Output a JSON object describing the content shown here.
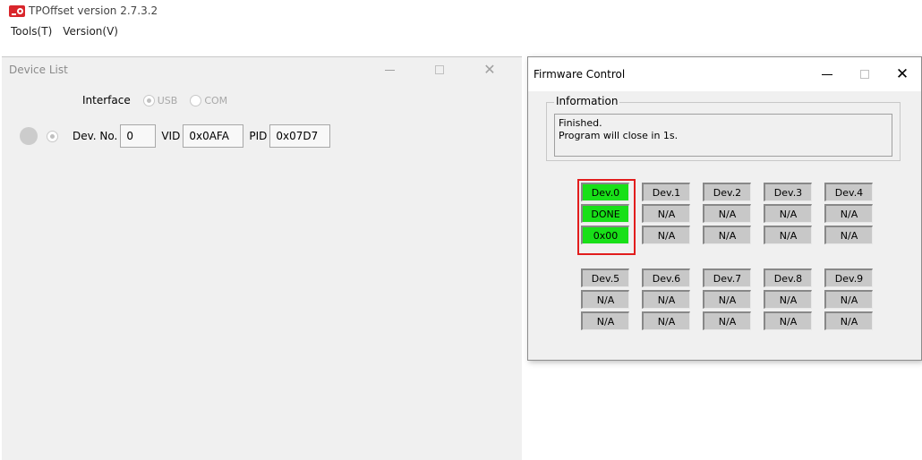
{
  "app": {
    "title": "TPOffset version 2.7.3.2",
    "logo_icon": "tpoffset-logo-icon"
  },
  "menu": [
    {
      "label": "Tools(T)"
    },
    {
      "label": "Version(V)"
    }
  ],
  "device_list": {
    "title": "Device List",
    "controls": {
      "minimize": "—",
      "maximize": "",
      "close": "✕"
    },
    "interface": {
      "label": "Interface",
      "options": [
        {
          "label": "USB",
          "selected": true,
          "enabled": false
        },
        {
          "label": "COM",
          "selected": false,
          "enabled": false
        }
      ]
    },
    "device": {
      "led_color": "#cccccc",
      "dev_no_label": "Dev. No.",
      "dev_no": "0",
      "vid_label": "VID",
      "vid": "0x0AFA",
      "pid_label": "PID",
      "pid": "0x07D7"
    }
  },
  "firmware_control": {
    "title": "Firmware Control",
    "controls": {
      "minimize": "—",
      "maximize": "",
      "close": "✕"
    },
    "information": {
      "legend": "Information",
      "line1": "Finished.",
      "line2": "Program will close in 1s."
    },
    "status_colors": {
      "ok": "#18e018",
      "idle": "#c8c8c8",
      "highlight": "#e21d1d"
    },
    "devices": [
      {
        "name": "Dev.0",
        "status": "DONE",
        "code": "0x00",
        "ok": true
      },
      {
        "name": "Dev.1",
        "status": "N/A",
        "code": "N/A",
        "ok": false
      },
      {
        "name": "Dev.2",
        "status": "N/A",
        "code": "N/A",
        "ok": false
      },
      {
        "name": "Dev.3",
        "status": "N/A",
        "code": "N/A",
        "ok": false
      },
      {
        "name": "Dev.4",
        "status": "N/A",
        "code": "N/A",
        "ok": false
      },
      {
        "name": "Dev.5",
        "status": "N/A",
        "code": "N/A",
        "ok": false
      },
      {
        "name": "Dev.6",
        "status": "N/A",
        "code": "N/A",
        "ok": false
      },
      {
        "name": "Dev.7",
        "status": "N/A",
        "code": "N/A",
        "ok": false
      },
      {
        "name": "Dev.8",
        "status": "N/A",
        "code": "N/A",
        "ok": false
      },
      {
        "name": "Dev.9",
        "status": "N/A",
        "code": "N/A",
        "ok": false
      }
    ]
  }
}
